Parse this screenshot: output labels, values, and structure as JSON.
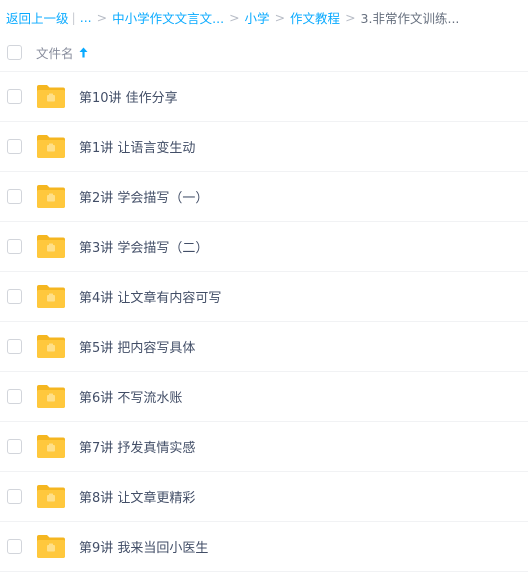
{
  "breadcrumb": {
    "back": "返回上一级",
    "ellipsis": "...",
    "items": [
      "中小学作文文言文...",
      "小学",
      "作文教程"
    ],
    "current": "3.非常作文训练...",
    "separator": ">",
    "pipe": "|"
  },
  "header": {
    "file_name_label": "文件名",
    "sort_direction": "ascending"
  },
  "files": [
    {
      "name": "第10讲 佳作分享",
      "type": "folder"
    },
    {
      "name": "第1讲 让语言变生动",
      "type": "folder"
    },
    {
      "name": "第2讲 学会描写（一）",
      "type": "folder"
    },
    {
      "name": "第3讲 学会描写（二）",
      "type": "folder"
    },
    {
      "name": "第4讲 让文章有内容可写",
      "type": "folder"
    },
    {
      "name": "第5讲 把内容写具体",
      "type": "folder"
    },
    {
      "name": "第6讲 不写流水账",
      "type": "folder"
    },
    {
      "name": "第7讲 抒发真情实感",
      "type": "folder"
    },
    {
      "name": "第8讲 让文章更精彩",
      "type": "folder"
    },
    {
      "name": "第9讲 我来当回小医生",
      "type": "folder"
    }
  ],
  "colors": {
    "link": "#09aaff",
    "folder": "#ffc52e",
    "text": "#424e67"
  },
  "icons": {
    "folder": "folder-icon",
    "sort": "arrow-up-icon",
    "checkbox": "checkbox-icon"
  }
}
